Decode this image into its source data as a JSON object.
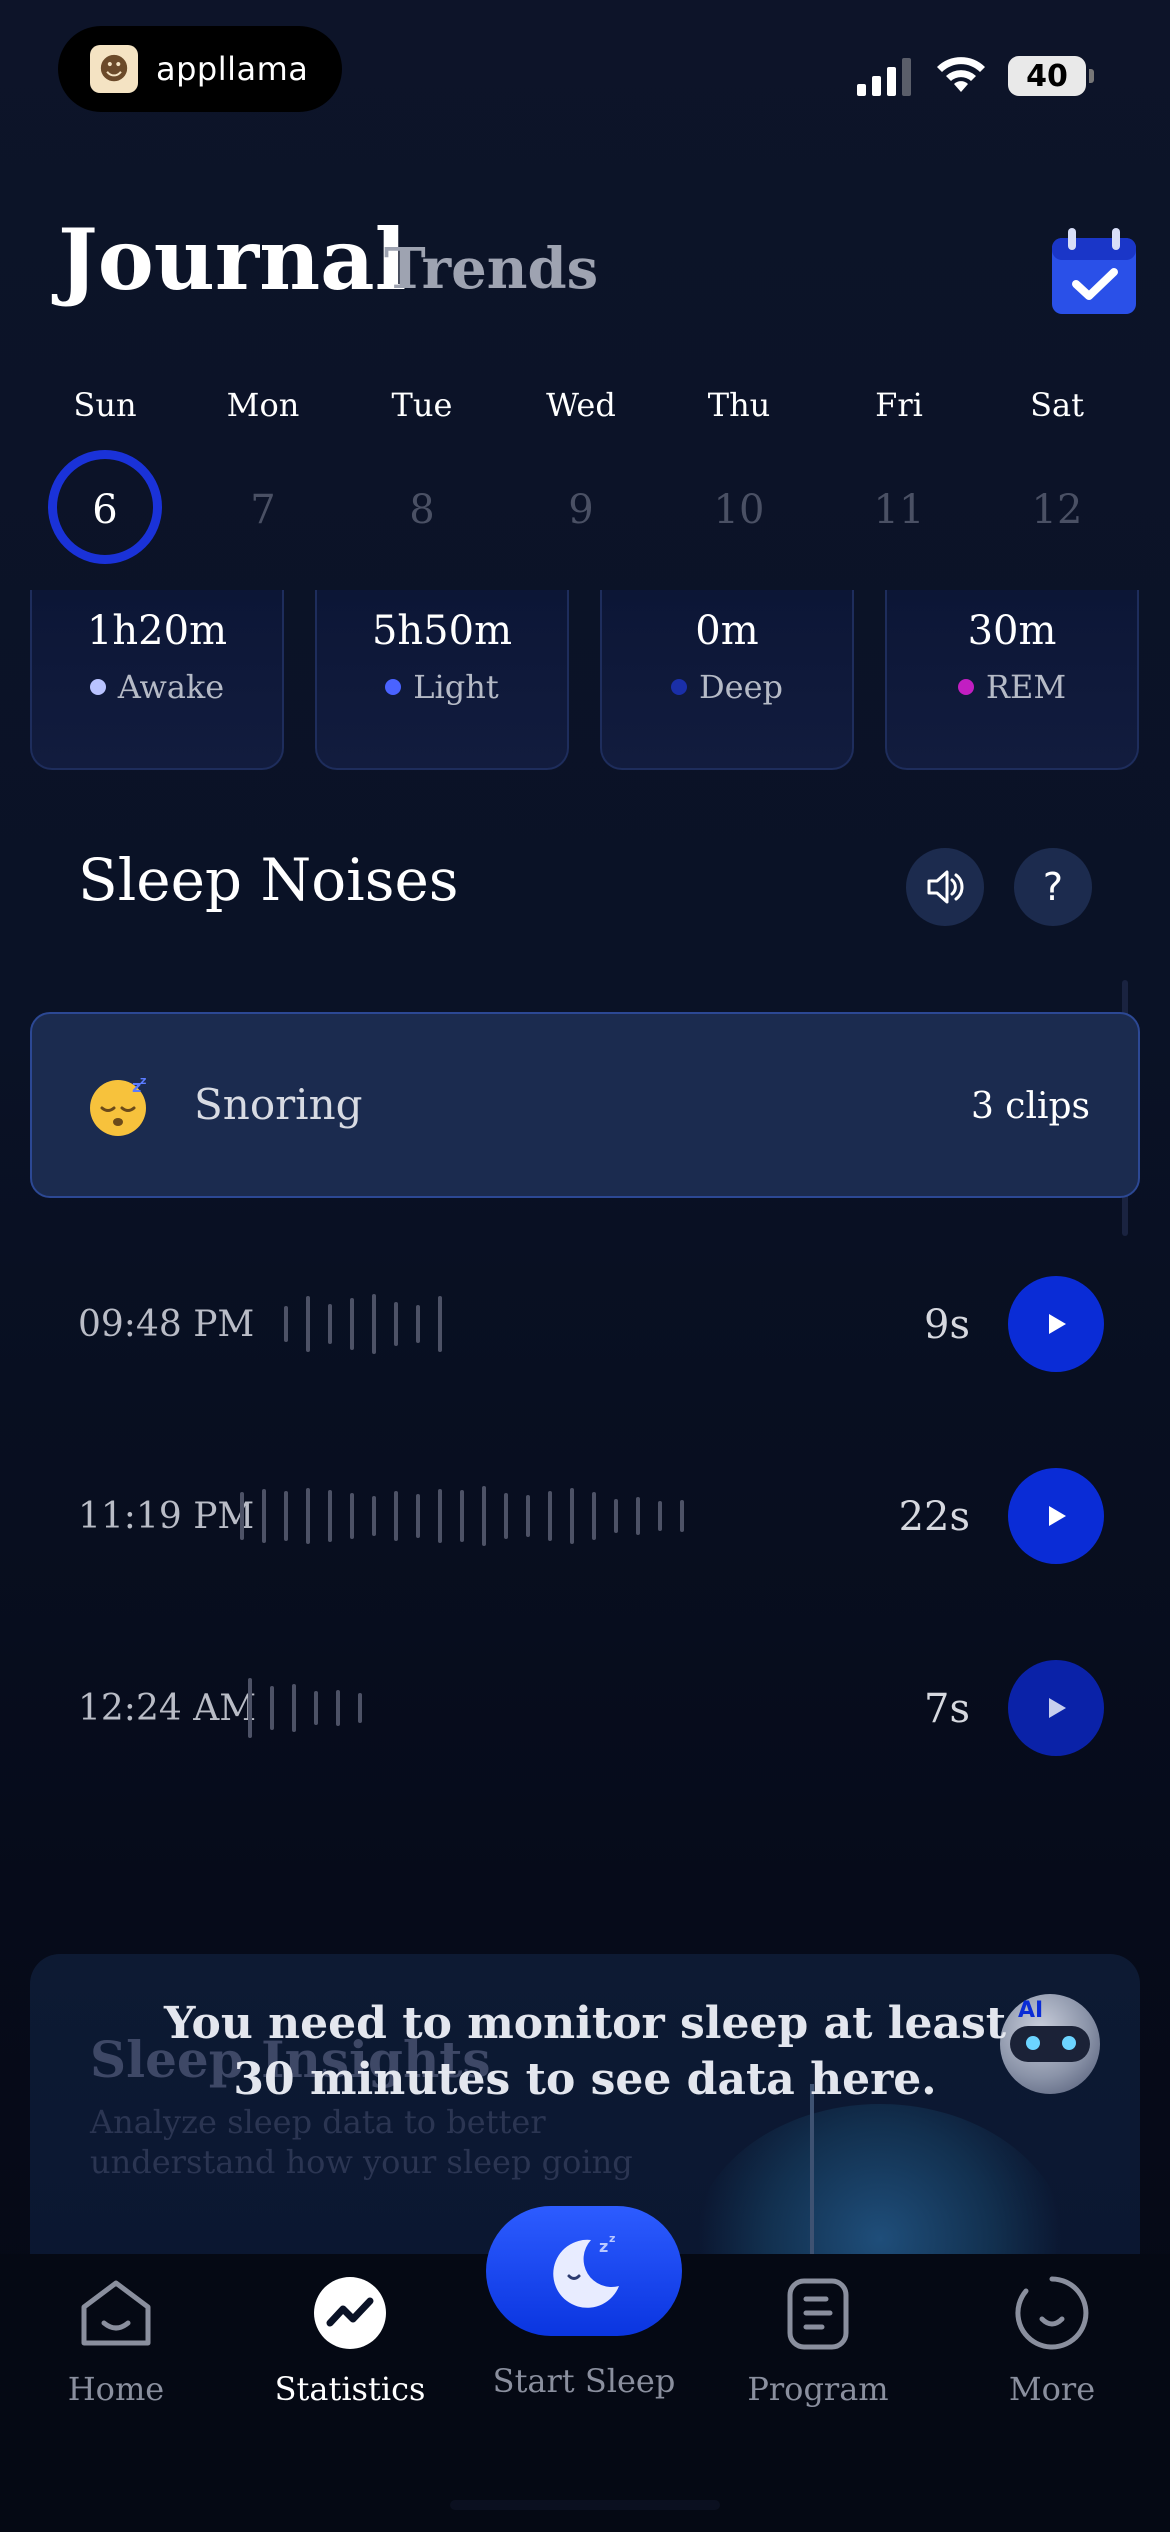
{
  "status_bar": {
    "brand_name": "appllama",
    "battery": "40"
  },
  "header": {
    "title": "Journal",
    "secondary_tab": "Trends"
  },
  "week": {
    "days": [
      {
        "name": "Sun",
        "date": "6",
        "selected": true
      },
      {
        "name": "Mon",
        "date": "7",
        "selected": false
      },
      {
        "name": "Tue",
        "date": "8",
        "selected": false
      },
      {
        "name": "Wed",
        "date": "9",
        "selected": false
      },
      {
        "name": "Thu",
        "date": "10",
        "selected": false
      },
      {
        "name": "Fri",
        "date": "11",
        "selected": false
      },
      {
        "name": "Sat",
        "date": "12",
        "selected": false
      }
    ]
  },
  "stages": [
    {
      "value": "1h20m",
      "label": "Awake",
      "color": "#b9c3ff"
    },
    {
      "value": "5h50m",
      "label": "Light",
      "color": "#4a63ff"
    },
    {
      "value": "0m",
      "label": "Deep",
      "color": "#1a2fa8"
    },
    {
      "value": "30m",
      "label": "REM",
      "color": "#c21ec2"
    }
  ],
  "noises": {
    "title": "Sleep Noises",
    "sound_icon": "speaker-icon",
    "help_label": "?",
    "category": {
      "label": "Snoring",
      "count": "3 clips",
      "emoji": "sleeping-face-icon"
    },
    "clips": [
      {
        "time": "09:48 PM",
        "duration": "9s"
      },
      {
        "time": "11:19 PM",
        "duration": "22s"
      },
      {
        "time": "12:24 AM",
        "duration": "7s"
      }
    ]
  },
  "insights": {
    "title": "Sleep Insights",
    "subtitle": "Analyze sleep data to better understand how your sleep going",
    "robot_badge": "AI",
    "message": "You need to monitor sleep at least 30 minutes to see data here."
  },
  "tabbar": {
    "home": "Home",
    "statistics": "Statistics",
    "start_sleep": "Start Sleep",
    "program": "Program",
    "more": "More"
  },
  "colors": {
    "accent": "#0a2cd6",
    "background": "#0a1226",
    "card": "#1b2b4f"
  }
}
